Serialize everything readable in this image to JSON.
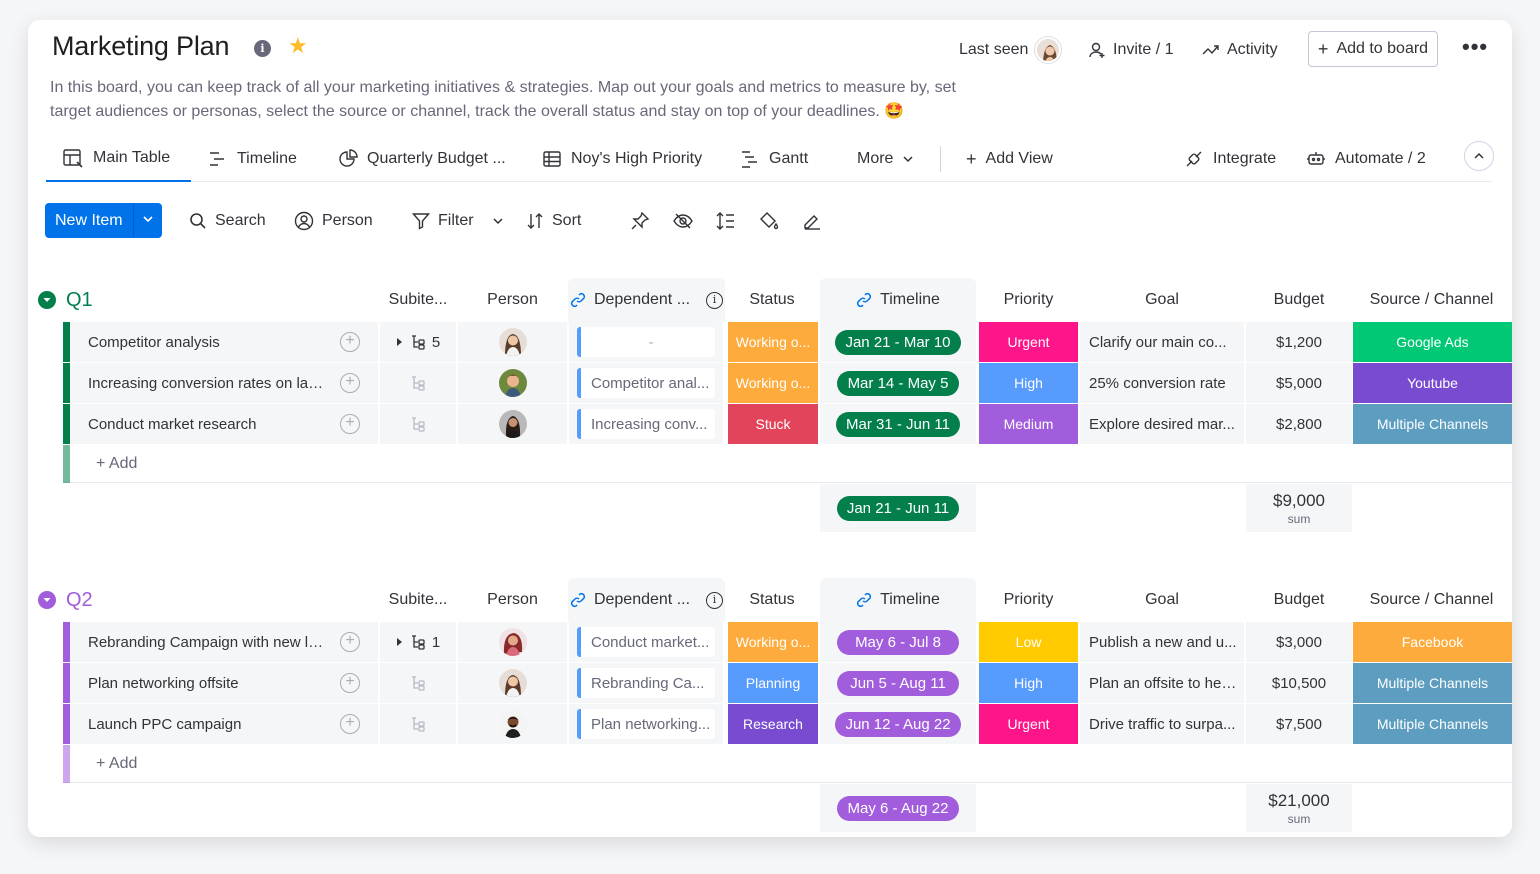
{
  "header": {
    "title": "Marketing Plan",
    "last_seen": "Last seen",
    "invite": "Invite / 1",
    "activity": "Activity",
    "add_to_board": "Add to board",
    "description": "In this board, you can keep track of all your marketing initiatives & strategies. Map out your goals and metrics to measure by, set target audiences or personas, select the source or channel, track the overall status and stay on top of your deadlines. 🤩"
  },
  "tabs": {
    "main_table": "Main Table",
    "timeline": "Timeline",
    "quarterly_budget": "Quarterly Budget ...",
    "high_priority": "Noy's High Priority",
    "gantt": "Gantt",
    "more": "More",
    "add_view": "Add View",
    "integrate": "Integrate",
    "automate": "Automate / 2"
  },
  "toolbar": {
    "new_item": "New Item",
    "search": "Search",
    "person": "Person",
    "filter": "Filter",
    "sort": "Sort"
  },
  "columns": {
    "subitems": "Subite...",
    "person": "Person",
    "dependent": "Dependent ...",
    "status": "Status",
    "timeline": "Timeline",
    "priority": "Priority",
    "goal": "Goal",
    "budget": "Budget",
    "source": "Source / Channel"
  },
  "colors": {
    "q1": "#037f4c",
    "q2": "#a25ddc",
    "working": "#fdab3d",
    "stuck": "#e2445c",
    "planning": "#579bfc",
    "research": "#784bd1",
    "urgent": "#ff158a",
    "high": "#579bfc",
    "medium": "#a25ddc",
    "low": "#ffcb00",
    "google_ads": "#00c875",
    "youtube": "#784bd1",
    "multiple": "#5c9dc0",
    "facebook": "#fdab3d"
  },
  "groups": [
    {
      "name": "Q1",
      "add_label": "+ Add",
      "timeline_total": "Jan 21 - Jun 11",
      "budget_sum": "$9,000",
      "sum_label": "sum",
      "rows": [
        {
          "name": "Competitor analysis",
          "subitems": "5",
          "dependent": "-",
          "status": "Working o...",
          "timeline": "Jan 21 - Mar 10",
          "priority": "Urgent",
          "goal": "Clarify our main co...",
          "budget": "$1,200",
          "source": "Google Ads"
        },
        {
          "name": "Increasing conversion rates on lan...",
          "subitems": "",
          "dependent": "Competitor anal...",
          "status": "Working o...",
          "timeline": "Mar 14 - May 5",
          "priority": "High",
          "goal": "25% conversion rate",
          "budget": "$5,000",
          "source": "Youtube"
        },
        {
          "name": "Conduct market research",
          "subitems": "",
          "dependent": "Increasing conv...",
          "status": "Stuck",
          "timeline": "Mar 31 - Jun 11",
          "priority": "Medium",
          "goal": "Explore desired mar...",
          "budget": "$2,800",
          "source": "Multiple Channels"
        }
      ]
    },
    {
      "name": "Q2",
      "add_label": "+ Add",
      "timeline_total": "May 6 - Aug 22",
      "budget_sum": "$21,000",
      "sum_label": "sum",
      "rows": [
        {
          "name": "Rebranding Campaign with new lo...",
          "subitems": "1",
          "dependent": "Conduct market...",
          "status": "Working o...",
          "timeline": "May 6 - Jul 8",
          "priority": "Low",
          "goal": "Publish a new and u...",
          "budget": "$3,000",
          "source": "Facebook"
        },
        {
          "name": "Plan networking offsite",
          "subitems": "",
          "dependent": "Rebranding Ca...",
          "status": "Planning",
          "timeline": "Jun 5 - Aug 11",
          "priority": "High",
          "goal": "Plan an offsite to hel...",
          "budget": "$10,500",
          "source": "Multiple Channels"
        },
        {
          "name": "Launch PPC campaign",
          "subitems": "",
          "dependent": "Plan networking...",
          "status": "Research",
          "timeline": "Jun 12 - Aug 22",
          "priority": "Urgent",
          "goal": "Drive traffic to surpa...",
          "budget": "$7,500",
          "source": "Multiple Channels"
        }
      ]
    }
  ]
}
